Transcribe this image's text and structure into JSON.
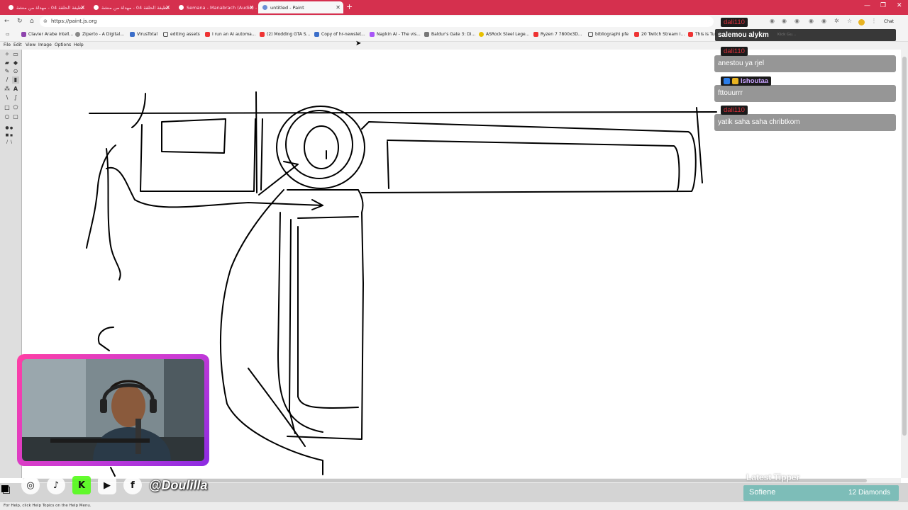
{
  "browser": {
    "tabs": [
      {
        "label": "خطيفة الحلقة 04 - مهداة من منشة"
      },
      {
        "label": "خطيفة الحلقة 04 - مهداة من منشة"
      },
      {
        "label": "Semana - Manabrach (Audio) - Yo"
      },
      {
        "label": "untitled - Paint",
        "active": true
      }
    ],
    "url": "https://paint.js.org",
    "bookmarks": [
      "Clavier Arabe Intell...",
      "Ziperto - A Digital...",
      "VirusTotal",
      "editing assets",
      "I run an AI automa...",
      "(2) Modding GTA S...",
      "Copy of hr-newslet...",
      "Napkin AI - The vis...",
      "Baldur's Gate 3: Di...",
      "ASRock Steel Lege...",
      "Ryzen 7 7800x3D...",
      "bibliographi pfe",
      "20 Twitch Stream I...",
      "This is Tur..."
    ],
    "chat_button": "Chat"
  },
  "paint": {
    "menu": [
      "File",
      "Edit",
      "View",
      "Image",
      "Options",
      "Help"
    ],
    "status": "For Help, click Help Topics on the Help Menu."
  },
  "chat": {
    "top": {
      "text": "salemou alykm",
      "ghost": "Kick Gu..."
    },
    "messages": [
      {
        "user": "dali110",
        "text": "anestou ya rjel",
        "user_color": "#e0303a"
      },
      {
        "user": "Ishoutaa",
        "text": "fttouurrr",
        "user_color": "#c9a2ff"
      },
      {
        "user": "dali110",
        "text": "yatik saha saha chribtkom",
        "user_color": "#e0303a"
      }
    ],
    "top_user": "dali110"
  },
  "overlay": {
    "handle": "@Doulilla",
    "social_icons": [
      "instagram-icon",
      "tiktok-icon",
      "kick-icon",
      "youtube-icon",
      "facebook-icon"
    ],
    "tipper": {
      "title": "Latest Tipper",
      "name": "Sofiene",
      "amount": "12 Diamonds"
    },
    "cam_border_colors": [
      "#ff3fa4",
      "#8b2be2"
    ]
  }
}
